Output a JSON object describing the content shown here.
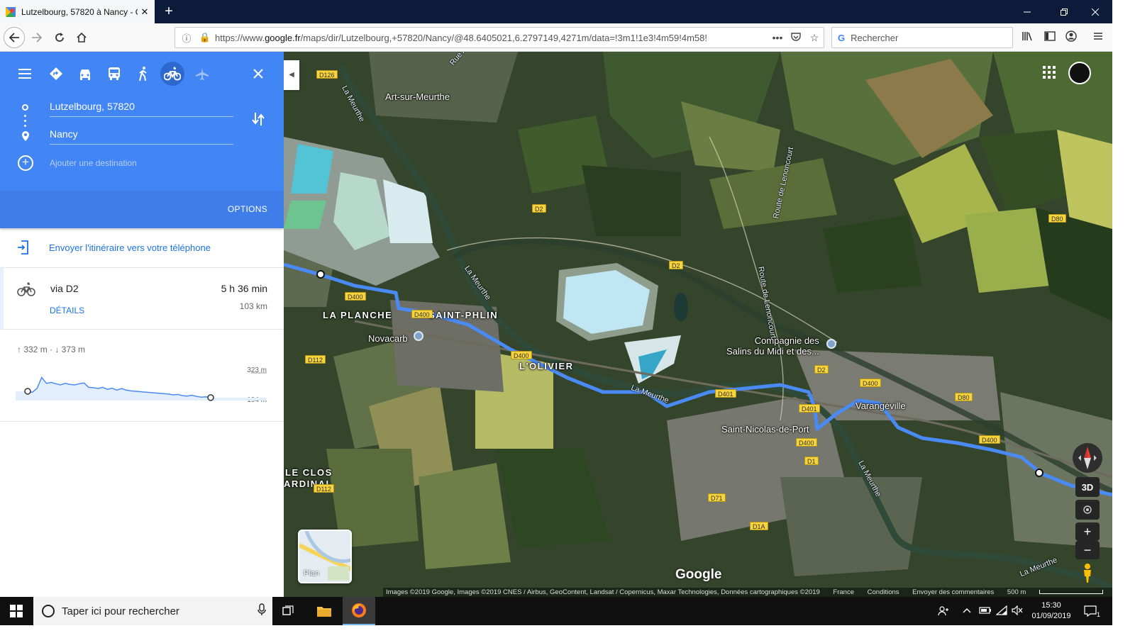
{
  "browser": {
    "tab_title": "Lutzelbourg, 57820 à Nancy - G",
    "tab_close": "✕",
    "new_tab": "+",
    "url_prefix": "https://www.",
    "url_domain": "google.fr",
    "url_rest": "/maps/dir/Lutzelbourg,+57820/Nancy/@48.6405021,6.2797149,4271m/data=!3m1!1e3!4m59!4m58!",
    "search_placeholder": "Rechercher",
    "more": "•••"
  },
  "directions": {
    "origin": "Lutzelbourg, 57820",
    "destination": "Nancy",
    "add_destination": "Ajouter une destination",
    "options_label": "OPTIONS",
    "send_to_phone": "Envoyer l'itinéraire vers votre téléphone",
    "route": {
      "via": "via D2",
      "duration": "5 h 36 min",
      "distance": "103 km",
      "details_label": "DÉTAILS"
    },
    "elevation": {
      "summary": "↑ 332 m · ↓ 373 m",
      "max_label": "323 m",
      "min_label": "194 m",
      "profile": [
        230,
        225,
        245,
        300,
        270,
        275,
        268,
        262,
        270,
        265,
        262,
        268,
        272,
        250,
        248,
        244,
        250,
        240,
        246,
        236,
        244,
        236,
        232,
        230,
        228,
        226,
        224,
        222,
        220,
        218,
        216,
        212,
        214,
        208,
        206,
        210,
        204,
        200,
        202,
        198
      ]
    }
  },
  "map": {
    "places": {
      "art_sur_meurthe": "Art-sur-Meurthe",
      "la_planche": "LA PLANCHE",
      "saint_phlin": "SAINT-PHLIN",
      "novacarb": "Novacarb",
      "lolivier": "L'OLIVIER",
      "compagnie": "Compagnie des\nSalins du Midi et des...",
      "varangeville": "Varangéville",
      "saint_nicolas": "Saint-Nicolas-de-Port",
      "le_clos": "LE CLOS",
      "cardinal": "ARDINAL"
    },
    "rivers": {
      "r1": "La Meurthe",
      "r2": "La Meurthe",
      "r3": "La Meurthe",
      "r4": "La Meurthe",
      "r5": "La Meurthe"
    },
    "roads": {
      "rue": "Rue A",
      "route_lenoncourt_1": "Route de Lenoncourt",
      "route_lenoncourt_2": "Route de Lenoncourt",
      "d126": "D126",
      "d2a": "D2",
      "d2b": "D2",
      "d2c": "D2",
      "d80a": "D80",
      "d80b": "D80",
      "d400a": "D400",
      "d400b": "D400",
      "d400c": "D400",
      "d400d": "D400",
      "d400e": "D400",
      "d400f": "D400",
      "d401a": "D401",
      "d401b": "D401",
      "d112a": "D112",
      "d112b": "D112",
      "d1": "D1",
      "d71": "D71",
      "d1a": "D1A"
    },
    "google_label": "Google",
    "plan_label": "Plan",
    "three_d_label": "3D",
    "zoom_in": "+",
    "zoom_out": "−",
    "attribution": {
      "images": "Images ©2019 Google, Images ©2019 CNES / Airbus, GeoContent, Landsat / Copernicus, Maxar Technologies, Données cartographiques ©2019",
      "country": "France",
      "terms": "Conditions",
      "feedback": "Envoyer des commentaires",
      "scale": "500 m"
    }
  },
  "taskbar": {
    "search_placeholder": "Taper ici pour rechercher",
    "time": "15:30",
    "date": "01/09/2019",
    "notification_count": "1"
  },
  "colors": {
    "blue_header": "#4285f4",
    "route_blue": "#4a8af4",
    "road_badge": "#f7d33c"
  }
}
